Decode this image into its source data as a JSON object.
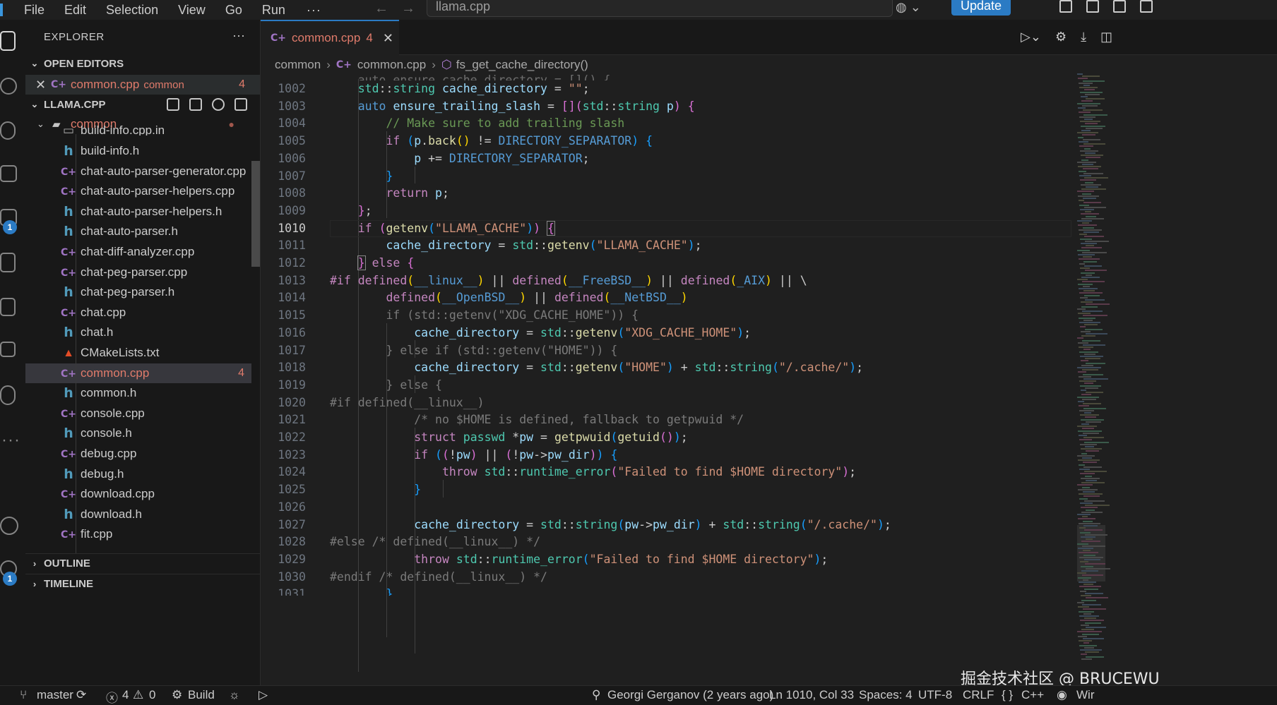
{
  "menu": [
    "File",
    "Edit",
    "Selection",
    "View",
    "Go",
    "Run",
    "···"
  ],
  "search_box": "llama.cpp",
  "update_label": "Update",
  "explorer": {
    "header": "EXPLORER",
    "more": "···",
    "open_editors_title": "OPEN EDITORS",
    "open_editor": {
      "name": "common.cpp",
      "folder": "common",
      "count": "4"
    },
    "project_title": "LLAMA.CPP",
    "folder_name": "common",
    "partial_top": "build-info.cpp.in",
    "files": [
      {
        "name": "build-info.h",
        "type": "h"
      },
      {
        "name": "chat-auto-parser-generator.cpp",
        "type": "cpp"
      },
      {
        "name": "chat-auto-parser-helpers.cpp",
        "type": "cpp"
      },
      {
        "name": "chat-auto-parser-helpers.h",
        "type": "h"
      },
      {
        "name": "chat-auto-parser.h",
        "type": "h"
      },
      {
        "name": "chat-diff-analyzer.cpp",
        "type": "cpp"
      },
      {
        "name": "chat-peg-parser.cpp",
        "type": "cpp"
      },
      {
        "name": "chat-peg-parser.h",
        "type": "h"
      },
      {
        "name": "chat.cpp",
        "type": "cpp"
      },
      {
        "name": "chat.h",
        "type": "h"
      },
      {
        "name": "CMakeLists.txt",
        "type": "cmake"
      },
      {
        "name": "common.cpp",
        "type": "cpp",
        "badge": "4",
        "selected": true
      },
      {
        "name": "common.h",
        "type": "h"
      },
      {
        "name": "console.cpp",
        "type": "cpp"
      },
      {
        "name": "console.h",
        "type": "h"
      },
      {
        "name": "debug.cpp",
        "type": "cpp"
      },
      {
        "name": "debug.h",
        "type": "h"
      },
      {
        "name": "download.cpp",
        "type": "cpp"
      },
      {
        "name": "download.h",
        "type": "h"
      },
      {
        "name": "fit.cpp",
        "type": "cpp"
      }
    ],
    "outline_title": "OUTLINE",
    "timeline_title": "TIMELINE"
  },
  "tab": {
    "name": "common.cpp",
    "count": "4",
    "close": "✕"
  },
  "breadcrumb": {
    "folder": "common",
    "file": "common.cpp",
    "symbol": "fs_get_cache_directory()"
  },
  "current_line": "1010",
  "status": {
    "branch": "master",
    "errors": "4",
    "warnings": "0",
    "build": "Build",
    "blame": "Georgi Gerganov (2 years ago)",
    "position": "Ln 1010, Col 33",
    "spaces": "Spaces: 4",
    "encoding": "UTF-8",
    "eol": "CRLF",
    "language": "C++",
    "trailing": "Wir"
  },
  "watermark": "掘金技术社区 @ BRUCEWU",
  "activity_badges": [
    "1",
    "1"
  ]
}
